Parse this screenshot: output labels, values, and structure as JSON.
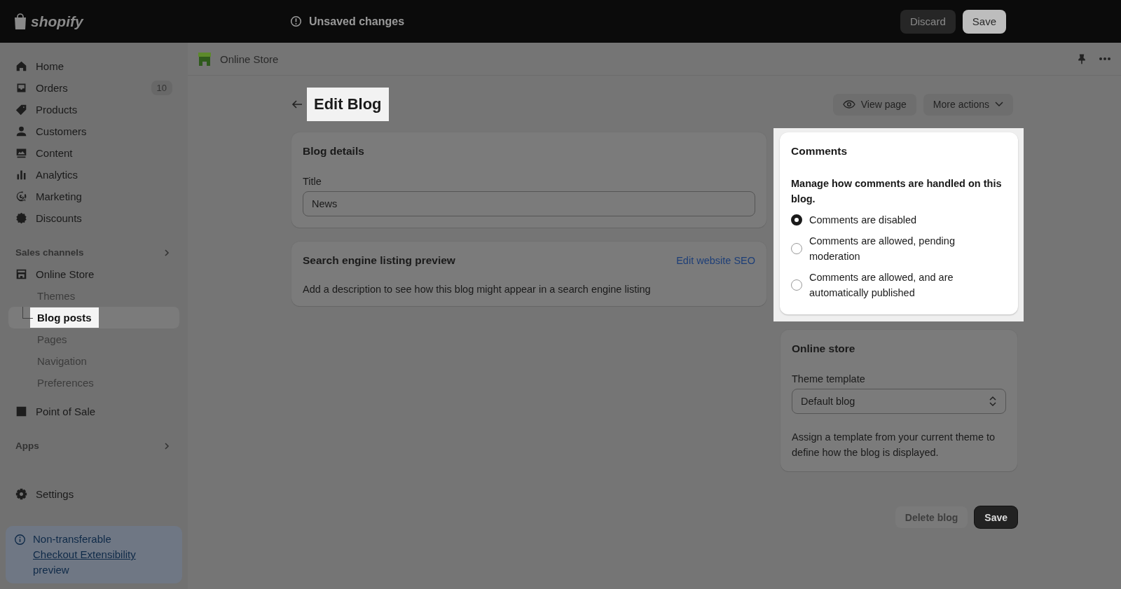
{
  "top_bar": {
    "logo": "shopify",
    "status": "Unsaved changes",
    "buttons": [
      {
        "label": "Discard",
        "kind": "secondary"
      },
      {
        "label": "Save",
        "kind": "primary"
      }
    ]
  },
  "sidebar": {
    "main_items": [
      {
        "label": "Home"
      },
      {
        "label": "Orders",
        "badge": "10"
      },
      {
        "label": "Products"
      },
      {
        "label": "Customers"
      },
      {
        "label": "Content"
      },
      {
        "label": "Analytics"
      },
      {
        "label": "Marketing"
      },
      {
        "label": "Discounts"
      }
    ],
    "sales_channels": {
      "heading": "Sales channels",
      "items": [
        {
          "label": "Online Store",
          "children": [
            {
              "label": "Themes",
              "selected": false,
              "highlighted": false
            },
            {
              "label": "Blog posts",
              "selected": true,
              "highlighted": true
            },
            {
              "label": "Pages",
              "selected": false,
              "highlighted": false
            },
            {
              "label": "Navigation",
              "selected": false,
              "highlighted": false
            },
            {
              "label": "Preferences",
              "selected": false,
              "highlighted": false
            }
          ]
        },
        {
          "label": "Point of Sale"
        }
      ]
    },
    "apps_heading": "Apps",
    "settings": "Settings",
    "notice": {
      "text": "Non-transferable",
      "link": "Checkout Extensibility",
      "text_after": "preview"
    }
  },
  "header": {
    "title": "Online Store"
  },
  "page": {
    "title": "Edit Blog",
    "title_highlighted": true,
    "actions": [
      {
        "label": "View page",
        "kind": "view"
      },
      {
        "label": "More actions",
        "kind": "menu"
      }
    ]
  },
  "blog_details": {
    "heading": "Blog details",
    "field_label": "Title",
    "field_value": "News"
  },
  "seo": {
    "heading": "Search engine listing preview",
    "link": "Edit website SEO",
    "description": "Add a description to see how this blog might appear in a search engine listing"
  },
  "comments": {
    "heading": "Comments",
    "highlighted": true,
    "prompt": "Manage how comments are handled on this blog.",
    "options": [
      {
        "label": "Comments are disabled",
        "selected": true
      },
      {
        "label": "Comments are allowed, pending moderation",
        "selected": false
      },
      {
        "label": "Comments are allowed, and are automatically published",
        "selected": false
      }
    ]
  },
  "online_store": {
    "heading": "Online store",
    "field_label": "Theme template",
    "select_value": "Default blog",
    "help": "Assign a template from your current theme to define how the blog is displayed."
  },
  "footer_buttons": [
    {
      "label": "Delete blog",
      "kind": "secondary",
      "disabled": true
    },
    {
      "label": "Save",
      "kind": "primary",
      "disabled": false
    }
  ]
}
